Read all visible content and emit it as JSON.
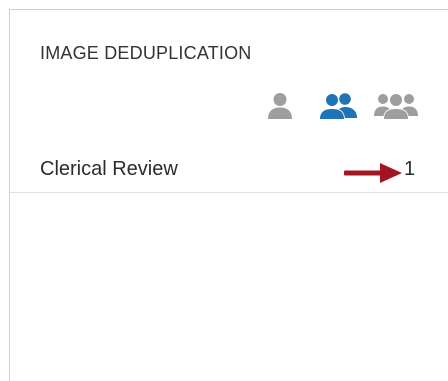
{
  "panel": {
    "title": "IMAGE DEDUPLICATION",
    "view_icons": [
      {
        "icon": "single-user-icon",
        "color": "#9e9e9e",
        "selected": false
      },
      {
        "icon": "two-users-icon",
        "color": "#1f73b7",
        "selected": true
      },
      {
        "icon": "group-users-icon",
        "color": "#9e9e9e",
        "selected": false
      }
    ],
    "rows": [
      {
        "label": "Clerical Review",
        "count": "1",
        "indicator": "arrow-right-icon",
        "indicator_color": "#a31621"
      }
    ]
  }
}
